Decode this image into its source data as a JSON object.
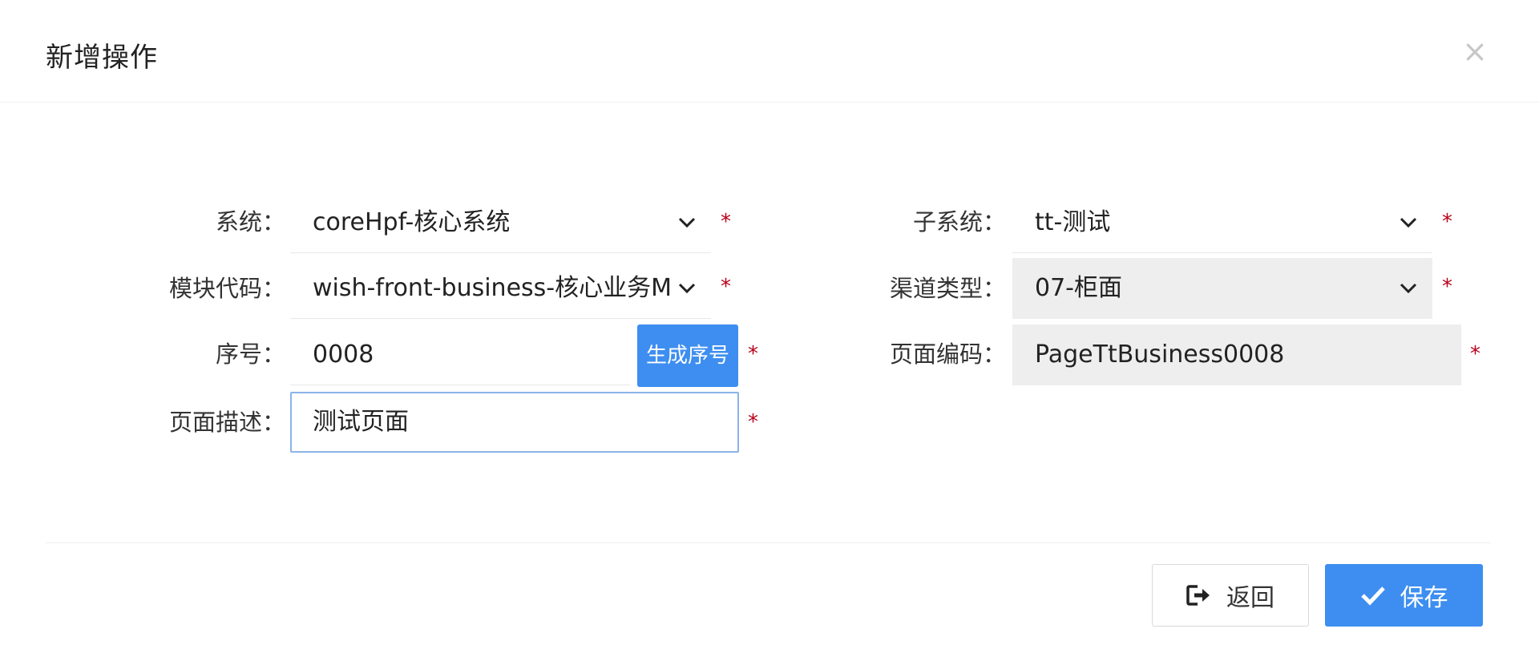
{
  "dialog": {
    "title": "新增操作",
    "close_icon": "close-icon"
  },
  "form": {
    "system": {
      "label": "系统：",
      "value": "coreHpf-核心系统",
      "required": "*"
    },
    "subsystem": {
      "label": "子系统：",
      "value": "tt-测试",
      "required": "*"
    },
    "module_code": {
      "label": "模块代码：",
      "value": "wish-front-business-核心业务M",
      "required": "*"
    },
    "channel_type": {
      "label": "渠道类型：",
      "value": "07-柜面",
      "required": "*"
    },
    "sequence": {
      "label": "序号：",
      "value": "0008",
      "required": "*",
      "generate_button": "生成序号"
    },
    "page_code": {
      "label": "页面编码：",
      "value": "PageTtBusiness0008",
      "required": "*"
    },
    "page_desc": {
      "label": "页面描述：",
      "value": "测试页面",
      "required": "*"
    }
  },
  "footer": {
    "back_label": "返回",
    "save_label": "保存"
  },
  "colors": {
    "accent": "#3d8ef0",
    "required": "#b9001a",
    "disabled_bg": "#eeeeee"
  }
}
